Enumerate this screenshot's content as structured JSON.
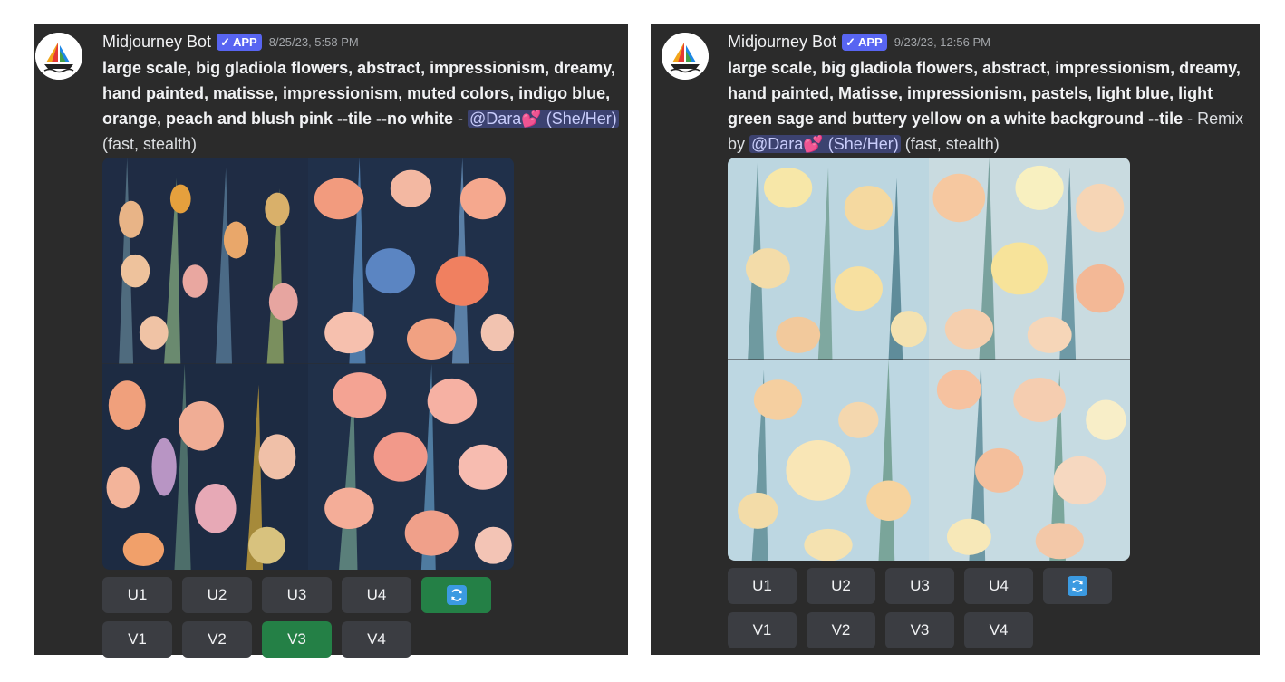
{
  "colors": {
    "panel": "#2b2b2b",
    "badge": "#5865f2",
    "button": "#3b3d42",
    "button_active": "#248046",
    "mention_bg": "#3c4270",
    "mention_text": "#c9cdfb"
  },
  "messages": [
    {
      "author": "Midjourney Bot",
      "badge": "APP",
      "badge_icon": "check-icon",
      "timestamp": "8/25/23, 5:58 PM",
      "prompt_bold": "large scale, big gladiola flowers, abstract, impressionism, dreamy, hand painted, matisse, impressionism, muted colors, indigo blue, orange, peach and blush pink --tile --no white",
      "prompt_sep": " - ",
      "mention": "@Dara💕 (She/Her)",
      "suffix": " (fast, stealth)",
      "upscale_buttons": [
        "U1",
        "U2",
        "U3",
        "U4"
      ],
      "variation_buttons": [
        "V1",
        "V2",
        "V3",
        "V4"
      ],
      "reroll_icon": "refresh-icon",
      "active_buttons": [
        "reroll",
        "V3"
      ],
      "image_theme": "dark indigo background, peach, blush pink and orange gladiolas"
    },
    {
      "author": "Midjourney Bot",
      "badge": "APP",
      "badge_icon": "check-icon",
      "timestamp": "9/23/23, 12:56 PM",
      "prompt_bold": "large scale, big gladiola flowers, abstract, impressionism, dreamy, hand painted, Matisse, impressionism, pastels, light blue, light green sage and buttery yellow on a white background --tile",
      "prompt_sep": " - Remix by ",
      "mention": "@Dara💕 (She/Her)",
      "suffix": " (fast, stealth)",
      "upscale_buttons": [
        "U1",
        "U2",
        "U3",
        "U4"
      ],
      "variation_buttons": [
        "V1",
        "V2",
        "V3",
        "V4"
      ],
      "reroll_icon": "refresh-icon",
      "active_buttons": [],
      "image_theme": "light blue background, buttery yellow and peach gladiolas with sage leaves"
    }
  ]
}
